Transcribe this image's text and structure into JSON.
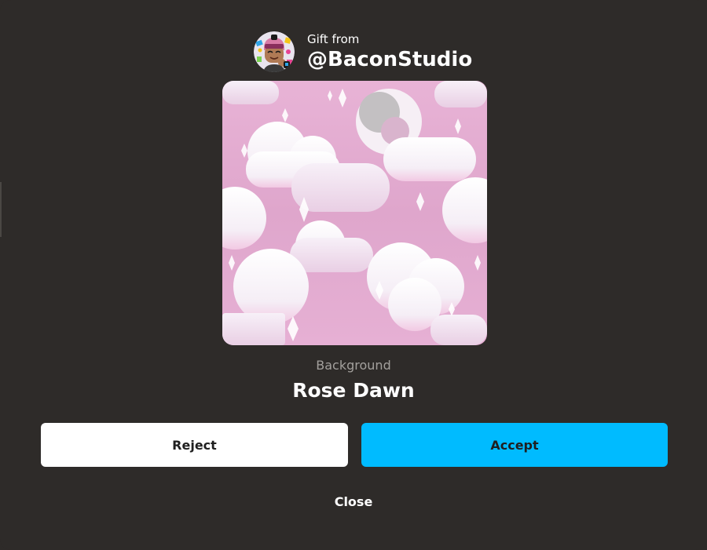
{
  "gift": {
    "from_label": "Gift from",
    "sender_handle": "@BaconStudio"
  },
  "item": {
    "type": "Background",
    "name": "Rose Dawn"
  },
  "actions": {
    "reject_label": "Reject",
    "accept_label": "Accept",
    "close_label": "Close"
  },
  "colors": {
    "background": "#2e2b29",
    "accept": "#00bbff",
    "reject": "#ffffff",
    "preview_sky": "#e7b5d9"
  },
  "icons": {
    "avatar": "sender-avatar",
    "preview": "rose-dawn-clouds-image"
  }
}
